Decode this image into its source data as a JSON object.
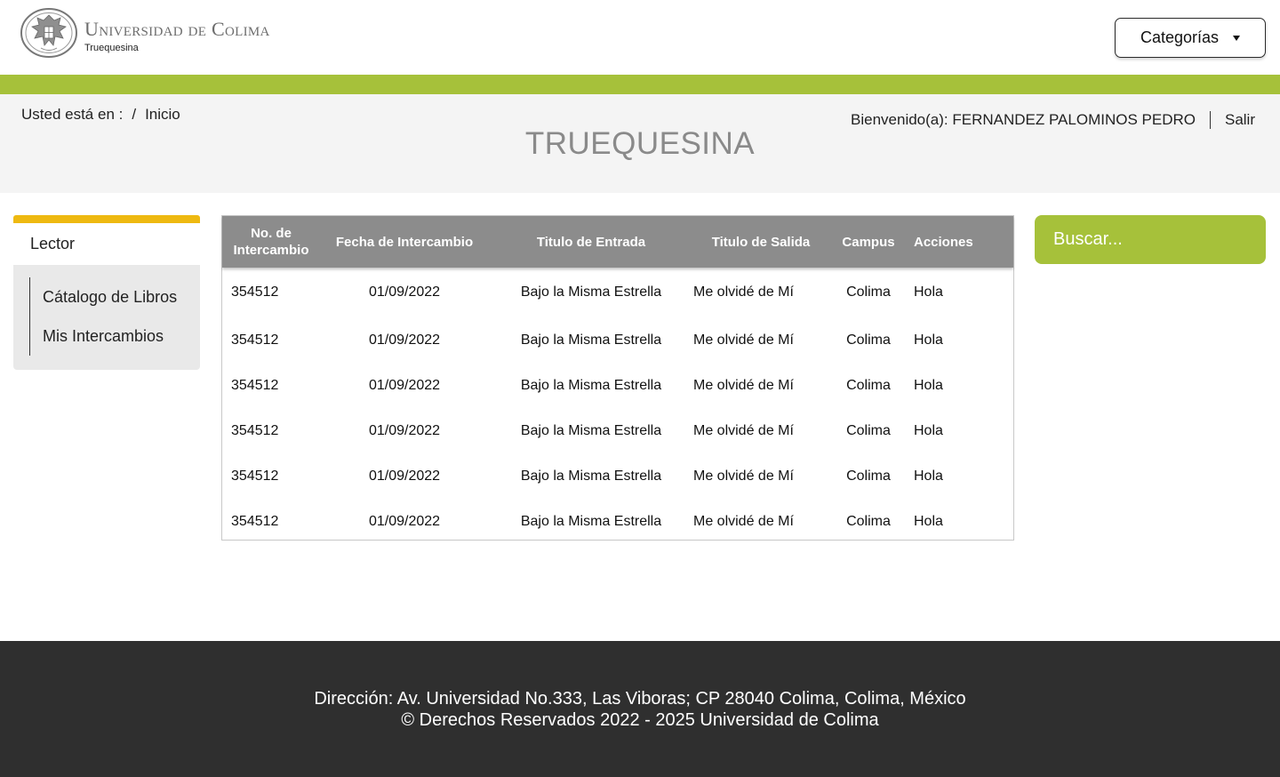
{
  "header": {
    "university_name": "Universidad de Colima",
    "subtitle": "Truequesina",
    "categories_label": "Categorías"
  },
  "subheader": {
    "breadcrumb_prefix": "Usted está en :",
    "breadcrumb_sep": "/",
    "breadcrumb_home": "Inicio",
    "page_title": "TRUEQUESINA",
    "welcome_text": "Bienvenido(a): FERNANDEZ PALOMINOS PEDRO",
    "logout_label": "Salir"
  },
  "sidebar": {
    "section_title": "Lector",
    "items": [
      {
        "label": "Cátalogo de Libros"
      },
      {
        "label": "Mis Intercambios"
      }
    ]
  },
  "table": {
    "columns": [
      "No. de Intercambio",
      "Fecha de Intercambio",
      "Titulo de Entrada",
      "Titulo de Salida",
      "Campus",
      "Acciones"
    ],
    "rows": [
      {
        "no": "354512",
        "fecha": "01/09/2022",
        "entrada": "Bajo la Misma Estrella",
        "salida": "Me olvidé de Mí",
        "campus": "Colima",
        "acciones": "Hola"
      },
      {
        "no": "354512",
        "fecha": "01/09/2022",
        "entrada": "Bajo la Misma Estrella",
        "salida": "Me olvidé de Mí",
        "campus": "Colima",
        "acciones": "Hola"
      },
      {
        "no": "354512",
        "fecha": "01/09/2022",
        "entrada": "Bajo la Misma Estrella",
        "salida": "Me olvidé de Mí",
        "campus": "Colima",
        "acciones": "Hola"
      },
      {
        "no": "354512",
        "fecha": "01/09/2022",
        "entrada": "Bajo la Misma Estrella",
        "salida": "Me olvidé de Mí",
        "campus": "Colima",
        "acciones": "Hola"
      },
      {
        "no": "354512",
        "fecha": "01/09/2022",
        "entrada": "Bajo la Misma Estrella",
        "salida": "Me olvidé de Mí",
        "campus": "Colima",
        "acciones": "Hola"
      },
      {
        "no": "354512",
        "fecha": "01/09/2022",
        "entrada": "Bajo la Misma Estrella",
        "salida": "Me olvidé de Mí",
        "campus": "Colima",
        "acciones": "Hola"
      }
    ]
  },
  "search": {
    "placeholder": "Buscar..."
  },
  "footer": {
    "address": "Dirección: Av. Universidad No.333, Las Viboras; CP 28040 Colima, Colima, México",
    "copyright": "© Derechos Reservados 2022 - 2025 Universidad de Colima"
  },
  "colors": {
    "brand_green": "#a6c13a",
    "accent_yellow": "#eeb911",
    "table_header": "#8c8c8c",
    "footer_bg": "#2f2f2f"
  }
}
